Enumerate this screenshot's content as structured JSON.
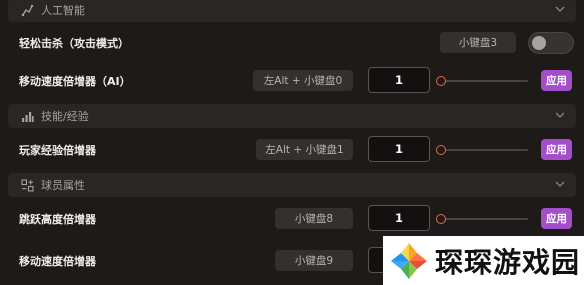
{
  "sections": {
    "ai": {
      "title": "人工智能"
    },
    "skills": {
      "title": "技能/经验"
    },
    "player": {
      "title": "球员属性"
    }
  },
  "rows": {
    "easy_kill": {
      "label": "轻松击杀（攻击模式）",
      "hotkey": "小键盘3",
      "toggle_on": false
    },
    "ai_speed": {
      "label": "移动速度倍增器（AI）",
      "hotkey": "左Alt + 小键盘0",
      "value": "1",
      "slider_position": 0.0,
      "apply": "应用"
    },
    "xp_mult": {
      "label": "玩家经验倍增器",
      "hotkey": "左Alt + 小键盘1",
      "value": "1",
      "slider_position": 0.0,
      "apply": "应用"
    },
    "jump_mult": {
      "label": "跳跃高度倍增器",
      "hotkey": "小键盘8",
      "value": "1",
      "slider_position": 0.0,
      "apply": "应用"
    },
    "move_speed": {
      "label": "移动速度倍增器",
      "hotkey": "小键盘9"
    }
  },
  "watermark": {
    "text": "琛琛游戏园"
  },
  "colors": {
    "accent": "#a24fc9",
    "slider_thumb": "#e86a3c",
    "background": "#1e1a1a"
  },
  "icons": [
    "robot-icon",
    "bar-chart-icon",
    "attributes-icon",
    "chevron-down-icon"
  ]
}
